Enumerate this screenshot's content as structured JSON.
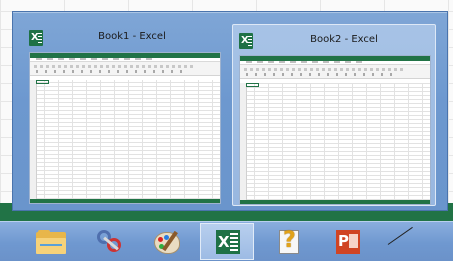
{
  "peek": {
    "windows": [
      {
        "title": "Book1 - Excel",
        "app_icon": "excel-icon",
        "hovered": false
      },
      {
        "title": "Book2 - Excel",
        "app_icon": "excel-icon",
        "hovered": true
      }
    ]
  },
  "taskbar": {
    "items": [
      {
        "name": "file-explorer",
        "icon": "folder-icon"
      },
      {
        "name": "snipping-tool",
        "icon": "scissors-icon"
      },
      {
        "name": "paint",
        "icon": "palette-icon"
      },
      {
        "name": "excel",
        "icon": "excel-icon",
        "active": true
      },
      {
        "name": "help",
        "icon": "help-icon"
      },
      {
        "name": "powerpoint",
        "icon": "powerpoint-icon"
      }
    ]
  },
  "colors": {
    "excel_green": "#217346",
    "taskbar_blue": "#6f98d0",
    "peek_highlight": "#a7c3e6",
    "powerpoint_red": "#d04423"
  }
}
